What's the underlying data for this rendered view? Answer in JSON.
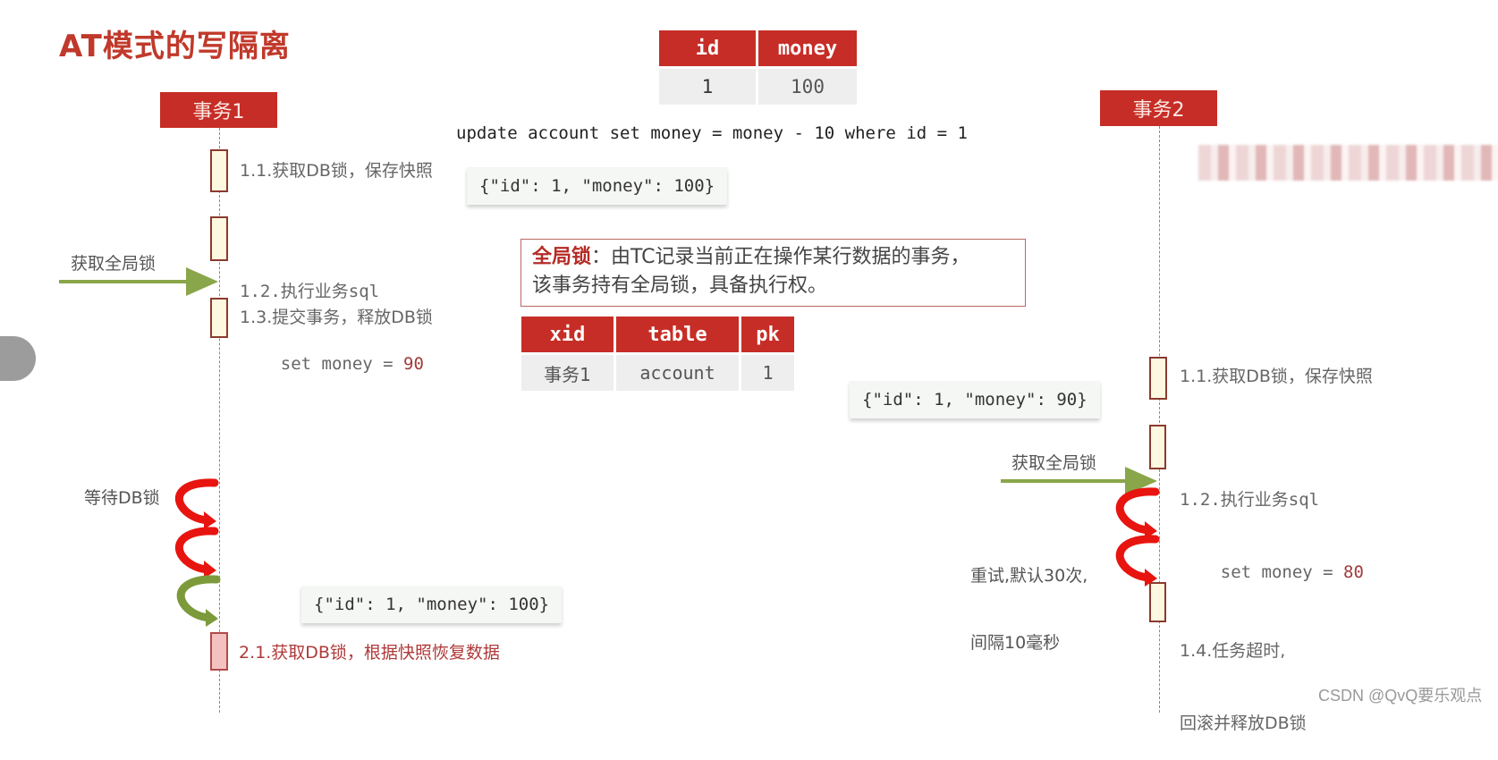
{
  "title": "AT模式的写隔离",
  "actors": {
    "tx1": "事务1",
    "tx2": "事务2"
  },
  "data_table": {
    "headers": [
      "id",
      "money"
    ],
    "rows": [
      [
        "1",
        "100"
      ]
    ]
  },
  "sql": "update account set money = money - 10 where id = 1",
  "global_lock_note": {
    "keyword": "全局锁",
    "line1": "：由TC记录当前正在操作某行数据的事务，",
    "line2": "该事务持有全局锁，具备执行权。"
  },
  "lock_table": {
    "headers": [
      "xid",
      "table",
      "pk"
    ],
    "rows": [
      [
        "事务1",
        "account",
        "1"
      ]
    ]
  },
  "tx1_steps": {
    "s11": "1.1.获取DB锁，保存快照",
    "s12_line1": "1.2.执行业务sql",
    "s12_line2_prefix": "    set money = ",
    "s12_value": "90",
    "s13": "1.3.提交事务，释放DB锁",
    "s21": "2.1.获取DB锁，根据快照恢复数据"
  },
  "tx2_steps": {
    "s11": "1.1.获取DB锁，保存快照",
    "s12_line1": "1.2.执行业务sql",
    "s12_line2_prefix": "    set money = ",
    "s12_value": "80",
    "s14_line1": "1.4.任务超时,",
    "s14_line2": "回滚并释放DB锁"
  },
  "snapshots": {
    "tx1_before": "{\"id\": 1, \"money\": 100}",
    "tx2_before": "{\"id\": 1, \"money\": 90}",
    "tx1_restore": "{\"id\": 1, \"money\": 100}"
  },
  "labels": {
    "tx1_get_global_lock": "获取全局锁",
    "tx1_wait_db_lock": "等待DB锁",
    "tx2_get_global_lock": "获取全局锁",
    "tx2_retry_line1": "重试,默认30次,",
    "tx2_retry_line2": "间隔10毫秒"
  },
  "watermark": "CSDN @QvQ要乐观点",
  "colors": {
    "accent_red": "#c62d26",
    "arrow_green": "#8aa64a",
    "arrow_red": "#e8140f",
    "activation_fill": "#fff8e1",
    "restore_fill": "#f4c1c1"
  }
}
